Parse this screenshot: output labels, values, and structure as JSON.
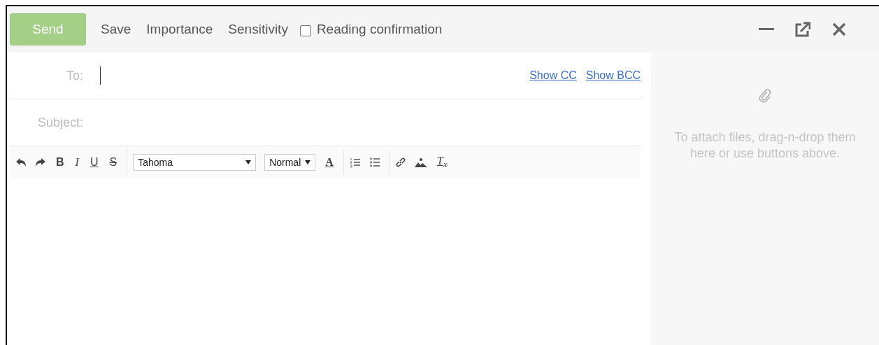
{
  "toolbar": {
    "send": {
      "label": "Send",
      "disabled": true
    },
    "actions": [
      "Save",
      "Importance",
      "Sensitivity"
    ],
    "reading_confirmation": {
      "label": "Reading confirmation",
      "checked": false
    }
  },
  "fields": [
    {
      "label": "To:"
    },
    {
      "label": "Subject:"
    }
  ],
  "links": [
    "Show CC",
    "Show BCC"
  ],
  "format_buttons": [
    "B",
    "I",
    "U",
    "S"
  ],
  "font": {
    "family": "Tahoma",
    "size": "Normal"
  },
  "font_color": "A",
  "clear_format": "T$_{x}$",
  "attach_hint": "To attach files, drag-n-drop them here or use buttons above."
}
